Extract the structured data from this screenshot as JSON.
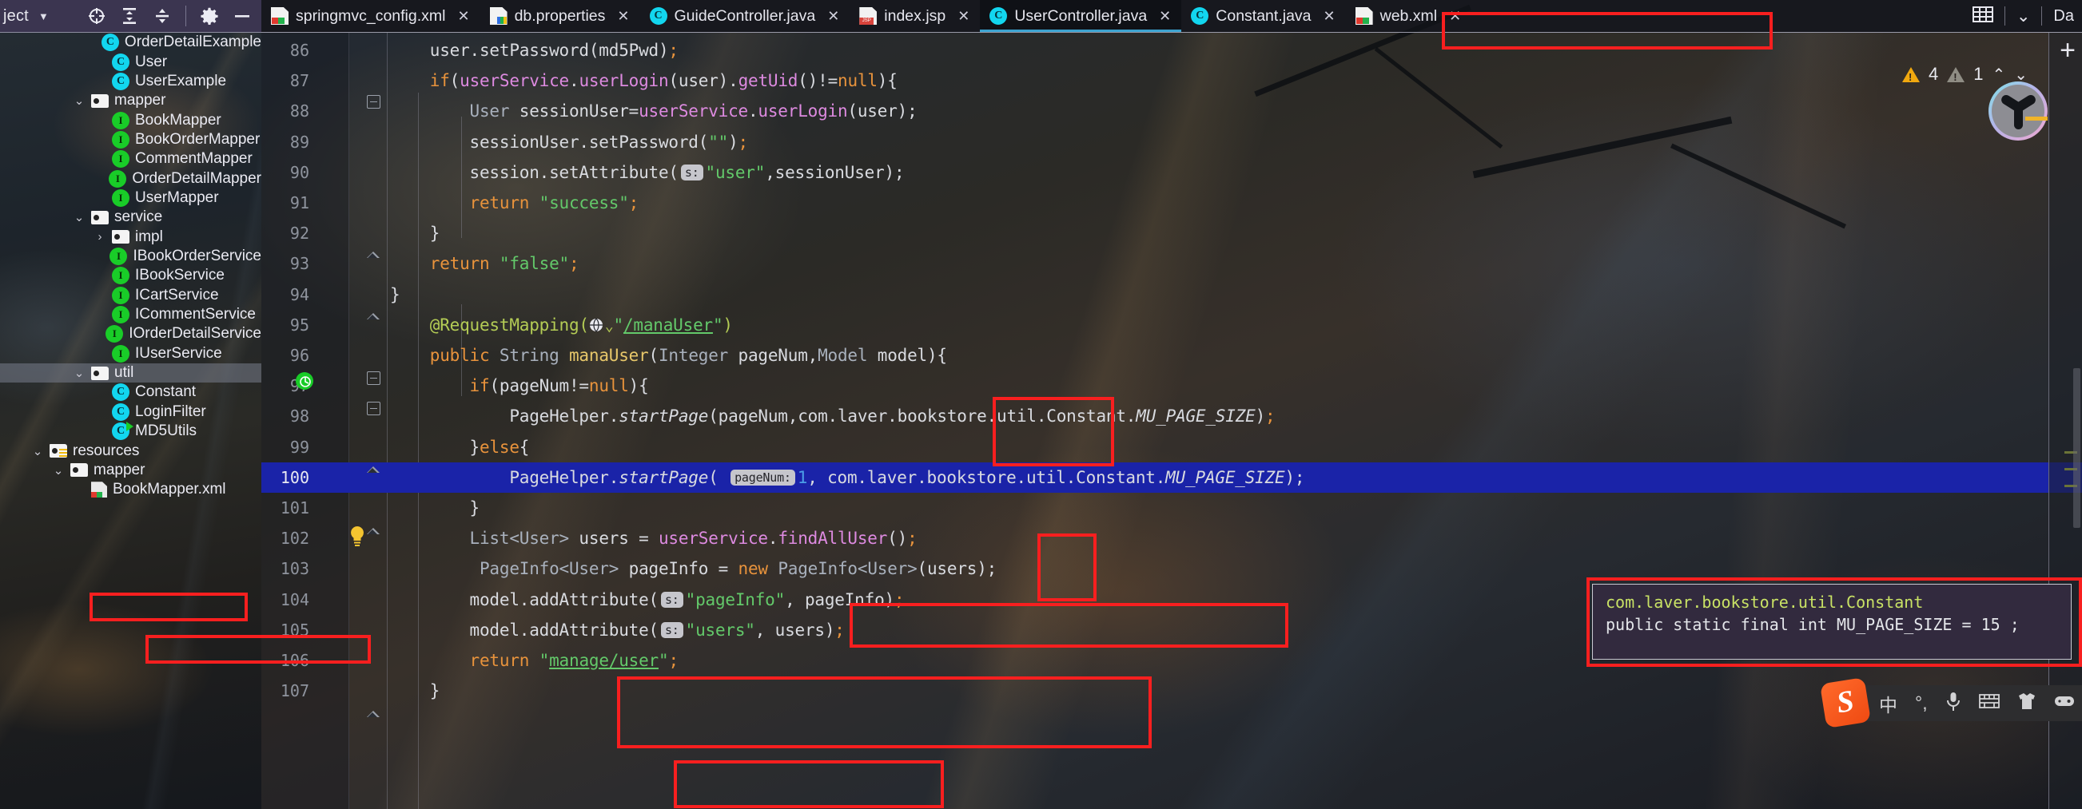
{
  "app": {
    "toolbar": {
      "title": "ject",
      "caret": "▼",
      "icons": [
        {
          "name": "locate-icon",
          "glyph": "crosshair"
        },
        {
          "name": "expand-all-icon",
          "glyph": "expand"
        },
        {
          "name": "collapse-all-icon",
          "glyph": "collapse"
        },
        {
          "name": "settings-gear-icon",
          "glyph": "gear"
        },
        {
          "name": "hide-panel-icon",
          "glyph": "minus"
        }
      ]
    }
  },
  "tabs": [
    {
      "label": "springmvc_config.xml",
      "icon": "xml-file-icon",
      "close": "✕",
      "active": false
    },
    {
      "label": "db.properties",
      "icon": "properties-file-icon",
      "close": "✕",
      "active": false
    },
    {
      "label": "GuideController.java",
      "icon": "java-class-icon",
      "close": "✕",
      "active": false
    },
    {
      "label": "index.jsp",
      "icon": "jsp-file-icon",
      "close": "✕",
      "active": false
    },
    {
      "label": "UserController.java",
      "icon": "java-class-icon",
      "close": "✕",
      "active": true
    },
    {
      "label": "Constant.java",
      "icon": "java-class-icon",
      "close": "✕",
      "active": false
    },
    {
      "label": "web.xml",
      "icon": "xml-file-icon",
      "close": "✕",
      "active": false
    }
  ],
  "tabbar_right": {
    "grid_icon": "grid-icon",
    "chevron": "⌄",
    "overflow_label": "Da"
  },
  "tree": [
    {
      "label": "OrderDetailExample",
      "icon": "java-class-icon",
      "indent": 4,
      "chev": "",
      "selected": false
    },
    {
      "label": "User",
      "icon": "java-class-icon",
      "indent": 4,
      "chev": "",
      "selected": false
    },
    {
      "label": "UserExample",
      "icon": "java-class-icon",
      "indent": 4,
      "chev": "",
      "selected": false
    },
    {
      "label": "mapper",
      "icon": "folder-icon",
      "indent": 3,
      "chev": "⌄",
      "selected": false
    },
    {
      "label": "BookMapper",
      "icon": "java-interface-icon",
      "indent": 4,
      "chev": "",
      "selected": false
    },
    {
      "label": "BookOrderMapper",
      "icon": "java-interface-icon",
      "indent": 4,
      "chev": "",
      "selected": false
    },
    {
      "label": "CommentMapper",
      "icon": "java-interface-icon",
      "indent": 4,
      "chev": "",
      "selected": false
    },
    {
      "label": "OrderDetailMapper",
      "icon": "java-interface-icon",
      "indent": 4,
      "chev": "",
      "selected": false
    },
    {
      "label": "UserMapper",
      "icon": "java-interface-icon",
      "indent": 4,
      "chev": "",
      "selected": false
    },
    {
      "label": "service",
      "icon": "folder-icon",
      "indent": 3,
      "chev": "⌄",
      "selected": false
    },
    {
      "label": "impl",
      "icon": "folder-icon",
      "indent": 4,
      "chev": "›",
      "selected": false
    },
    {
      "label": "IBookOrderService",
      "icon": "java-interface-icon",
      "indent": 4,
      "chev": "",
      "selected": false
    },
    {
      "label": "IBookService",
      "icon": "java-interface-icon",
      "indent": 4,
      "chev": "",
      "selected": false
    },
    {
      "label": "ICartService",
      "icon": "java-interface-icon",
      "indent": 4,
      "chev": "",
      "selected": false
    },
    {
      "label": "ICommentService",
      "icon": "java-interface-icon",
      "indent": 4,
      "chev": "",
      "selected": false
    },
    {
      "label": "IOrderDetailService",
      "icon": "java-interface-icon",
      "indent": 4,
      "chev": "",
      "selected": false
    },
    {
      "label": "IUserService",
      "icon": "java-interface-icon",
      "indent": 4,
      "chev": "",
      "selected": false
    },
    {
      "label": "util",
      "icon": "folder-icon",
      "indent": 3,
      "chev": "⌄",
      "selected": true
    },
    {
      "label": "Constant",
      "icon": "java-class-icon",
      "indent": 4,
      "chev": "",
      "selected": false
    },
    {
      "label": "LoginFilter",
      "icon": "java-class-icon",
      "indent": 4,
      "chev": "",
      "selected": false
    },
    {
      "label": "MD5Utils",
      "icon": "java-class-run-icon",
      "indent": 4,
      "chev": "",
      "selected": false
    },
    {
      "label": "resources",
      "icon": "resources-folder-icon",
      "indent": 1,
      "chev": "⌄",
      "selected": false
    },
    {
      "label": "mapper",
      "icon": "folder-plain-icon",
      "indent": 2,
      "chev": "⌄",
      "selected": false
    },
    {
      "label": "BookMapper.xml",
      "icon": "xml-file-icon",
      "indent": 3,
      "chev": "",
      "selected": false
    }
  ],
  "editor": {
    "filename": "UserController.java",
    "lines": [
      {
        "num": "86",
        "current": false,
        "fold": ""
      },
      {
        "num": "87",
        "current": false,
        "fold": "minus"
      },
      {
        "num": "88",
        "current": false,
        "fold": ""
      },
      {
        "num": "89",
        "current": false,
        "fold": ""
      },
      {
        "num": "90",
        "current": false,
        "fold": ""
      },
      {
        "num": "91",
        "current": false,
        "fold": ""
      },
      {
        "num": "92",
        "current": false,
        "fold": "up"
      },
      {
        "num": "93",
        "current": false,
        "fold": ""
      },
      {
        "num": "94",
        "current": false,
        "fold": "up"
      },
      {
        "num": "95",
        "current": false,
        "fold": ""
      },
      {
        "num": "96",
        "current": false,
        "fold": "minus"
      },
      {
        "num": "97",
        "current": false,
        "fold": "minus"
      },
      {
        "num": "98",
        "current": false,
        "fold": ""
      },
      {
        "num": "99",
        "current": false,
        "fold": "up"
      },
      {
        "num": "100",
        "current": true,
        "fold": ""
      },
      {
        "num": "101",
        "current": false,
        "fold": "up"
      },
      {
        "num": "102",
        "current": false,
        "fold": ""
      },
      {
        "num": "103",
        "current": false,
        "fold": ""
      },
      {
        "num": "104",
        "current": false,
        "fold": ""
      },
      {
        "num": "105",
        "current": false,
        "fold": ""
      },
      {
        "num": "106",
        "current": false,
        "fold": ""
      },
      {
        "num": "107",
        "current": false,
        "fold": "up"
      }
    ],
    "code_text": {
      "l86": "user.setPassword(md5Pwd);",
      "l87": "if(userService.userLogin(user).getUid()!=null){",
      "l88": "User sessionUser=userService.userLogin(user);",
      "l89": "sessionUser.setPassword(\"\");",
      "l90": "session.setAttribute( s: \"user\",sessionUser);",
      "l91": "return \"success\";",
      "l92": "}",
      "l93": "return \"false\";",
      "l94": "}",
      "l95": "@RequestMapping(\"/manaUser\")",
      "l96": "public String manaUser(Integer pageNum,Model model){",
      "l97": "if(pageNum!=null){",
      "l98": "PageHelper.startPage(pageNum,com.laver.bookstore.util.Constant.MU_PAGE_SIZE);",
      "l99": "}else{",
      "l100": "PageHelper.startPage( pageNum: 1, com.laver.bookstore.util.Constant.MU_PAGE_SIZE);",
      "l101": "}",
      "l102": "List<User> users = userService.findAllUser();",
      "l103": "PageInfo<User> pageInfo = new PageInfo<User>(users);",
      "l104": "model.addAttribute( s: \"pageInfo\", pageInfo);",
      "l105": "model.addAttribute( s: \"users\", users);",
      "l106": "return \"manage/user\";",
      "l107": "}"
    },
    "hints": {
      "s_label": "s:",
      "pagenum_label": "pageNum:"
    },
    "gutter_icons": {
      "bulb": "lightbulb-icon",
      "bean": "spring-bean-icon",
      "globe": "web-mapping-icon"
    }
  },
  "popup": {
    "line1": "com.laver.bookstore.util.Constant",
    "line2": "public static final int MU_PAGE_SIZE = 15 ;"
  },
  "inspections": {
    "warning_count": "4",
    "weak_warning_count": "1",
    "prev_glyph": "⌃",
    "next_glyph": "⌄",
    "warning_color": "#f0a80f",
    "weak_color": "#8f8d84"
  },
  "right_strip": {
    "plus_glyph": "+"
  },
  "ime": {
    "name": "sogou-ime",
    "logo_letter": "S",
    "items": [
      {
        "name": "chinese-mode-icon",
        "glyph": "中"
      },
      {
        "name": "punctuation-icon",
        "glyph": "°,"
      },
      {
        "name": "voice-input-icon",
        "glyph": "🎤"
      },
      {
        "name": "soft-keyboard-icon",
        "glyph": "⌨"
      },
      {
        "name": "skin-icon",
        "glyph": "👕"
      },
      {
        "name": "toolbox-icon",
        "glyph": "🎮"
      }
    ]
  },
  "gizmo": {
    "name": "3d-axis-gizmo",
    "accent": "#7fe3e8"
  },
  "annotations": {
    "boxes": [
      {
        "name": "tab-usercontroller-highlight"
      },
      {
        "name": "sidebar-util-highlight"
      },
      {
        "name": "sidebar-constant-highlight"
      },
      {
        "name": "param-pagenum-highlight"
      },
      {
        "name": "pagenum-hint-highlight"
      },
      {
        "name": "findalluser-highlight"
      },
      {
        "name": "addattribute-highlight"
      },
      {
        "name": "return-manage-user-highlight"
      },
      {
        "name": "popup-constant-highlight"
      }
    ],
    "color": "#f81f1f"
  }
}
